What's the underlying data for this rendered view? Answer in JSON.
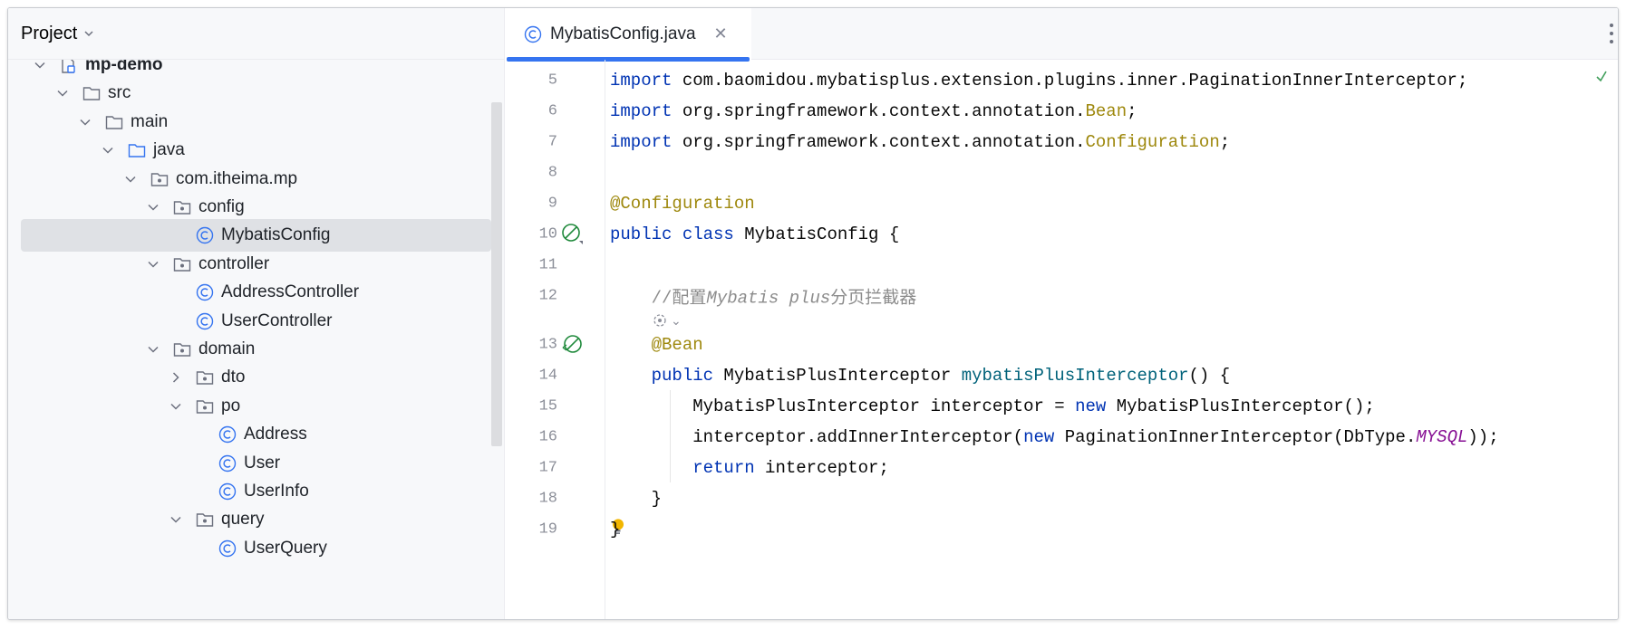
{
  "project_panel": {
    "title": "Project",
    "tree": [
      {
        "label": "mp-demo",
        "kind": "module",
        "expanded": true,
        "bold": true
      },
      {
        "label": "src",
        "kind": "folder",
        "expanded": true
      },
      {
        "label": "main",
        "kind": "folder",
        "expanded": true
      },
      {
        "label": "java",
        "kind": "source-folder",
        "expanded": true
      },
      {
        "label": "com.itheima.mp",
        "kind": "package",
        "expanded": true
      },
      {
        "label": "config",
        "kind": "package",
        "expanded": true
      },
      {
        "label": "MybatisConfig",
        "kind": "class",
        "selected": true
      },
      {
        "label": "controller",
        "kind": "package",
        "expanded": true
      },
      {
        "label": "AddressController",
        "kind": "class"
      },
      {
        "label": "UserController",
        "kind": "class"
      },
      {
        "label": "domain",
        "kind": "package",
        "expanded": true
      },
      {
        "label": "dto",
        "kind": "package",
        "expanded": false
      },
      {
        "label": "po",
        "kind": "package",
        "expanded": true
      },
      {
        "label": "Address",
        "kind": "class"
      },
      {
        "label": "User",
        "kind": "class"
      },
      {
        "label": "UserInfo",
        "kind": "class"
      },
      {
        "label": "query",
        "kind": "package",
        "expanded": true
      },
      {
        "label": "UserQuery",
        "kind": "class"
      }
    ]
  },
  "editor": {
    "tab_label": "MybatisConfig.java",
    "close_glyph": "✕",
    "inlay_hint": "⌄",
    "lines": [
      {
        "n": "5",
        "tokens": [
          {
            "t": "import",
            "c": "kw"
          },
          {
            "t": " com.baomidou.mybatisplus.extension.plugins.inner.PaginationInnerInterceptor;",
            "c": ""
          }
        ]
      },
      {
        "n": "6",
        "tokens": [
          {
            "t": "import",
            "c": "kw"
          },
          {
            "t": " org.springframework.context.annotation.",
            "c": ""
          },
          {
            "t": "Bean",
            "c": "cls"
          },
          {
            "t": ";",
            "c": ""
          }
        ]
      },
      {
        "n": "7",
        "tokens": [
          {
            "t": "import",
            "c": "kw"
          },
          {
            "t": " org.springframework.context.annotation.",
            "c": ""
          },
          {
            "t": "Configuration",
            "c": "cls"
          },
          {
            "t": ";",
            "c": ""
          }
        ]
      },
      {
        "n": "8",
        "tokens": []
      },
      {
        "n": "9",
        "tokens": [
          {
            "t": "@Configuration",
            "c": "ann"
          }
        ]
      },
      {
        "n": "10",
        "tokens": [
          {
            "t": "public class",
            "c": "kw"
          },
          {
            "t": " MybatisConfig {",
            "c": ""
          }
        ],
        "icon": "bean-icon"
      },
      {
        "n": "11",
        "tokens": []
      },
      {
        "n": "12",
        "tokens": [
          {
            "t": "    //配置",
            "c": "cmt-plain"
          },
          {
            "t": "Mybatis plus",
            "c": "cmt"
          },
          {
            "t": "分页拦截器",
            "c": "cmt-plain"
          }
        ]
      },
      {
        "n": "13",
        "tokens": [
          {
            "t": "    @Bean",
            "c": "ann"
          }
        ],
        "icon": "bean-method-icon"
      },
      {
        "n": "14",
        "tokens": [
          {
            "t": "    public",
            "c": "kw"
          },
          {
            "t": " MybatisPlusInterceptor ",
            "c": ""
          },
          {
            "t": "mybatisPlusInterceptor",
            "c": "fn"
          },
          {
            "t": "() {",
            "c": ""
          }
        ]
      },
      {
        "n": "15",
        "tokens": [
          {
            "t": "        MybatisPlusInterceptor interceptor = ",
            "c": ""
          },
          {
            "t": "new",
            "c": "kw"
          },
          {
            "t": " MybatisPlusInterceptor();",
            "c": ""
          }
        ]
      },
      {
        "n": "16",
        "tokens": [
          {
            "t": "        interceptor.addInnerInterceptor(",
            "c": ""
          },
          {
            "t": "new",
            "c": "kw"
          },
          {
            "t": " PaginationInnerInterceptor(DbType.",
            "c": ""
          },
          {
            "t": "MYSQL",
            "c": "const"
          },
          {
            "t": "));",
            "c": ""
          }
        ]
      },
      {
        "n": "17",
        "tokens": [
          {
            "t": "        ",
            "c": ""
          },
          {
            "t": "return",
            "c": "kw"
          },
          {
            "t": " interceptor;",
            "c": ""
          }
        ]
      },
      {
        "n": "18",
        "tokens": [
          {
            "t": "    }",
            "c": ""
          }
        ]
      },
      {
        "n": "19",
        "tokens": [
          {
            "t": "}",
            "c": ""
          }
        ],
        "icon": "bulb-icon"
      }
    ]
  },
  "colors": {
    "accent": "#3574f0",
    "keyword": "#0033b3",
    "annotation": "#9e880d",
    "method": "#00627a",
    "constant": "#871094",
    "comment": "#8c8c8c",
    "selection": "#dfe1e5",
    "spring_green": "#208a3c",
    "bulb": "#f2b600"
  }
}
